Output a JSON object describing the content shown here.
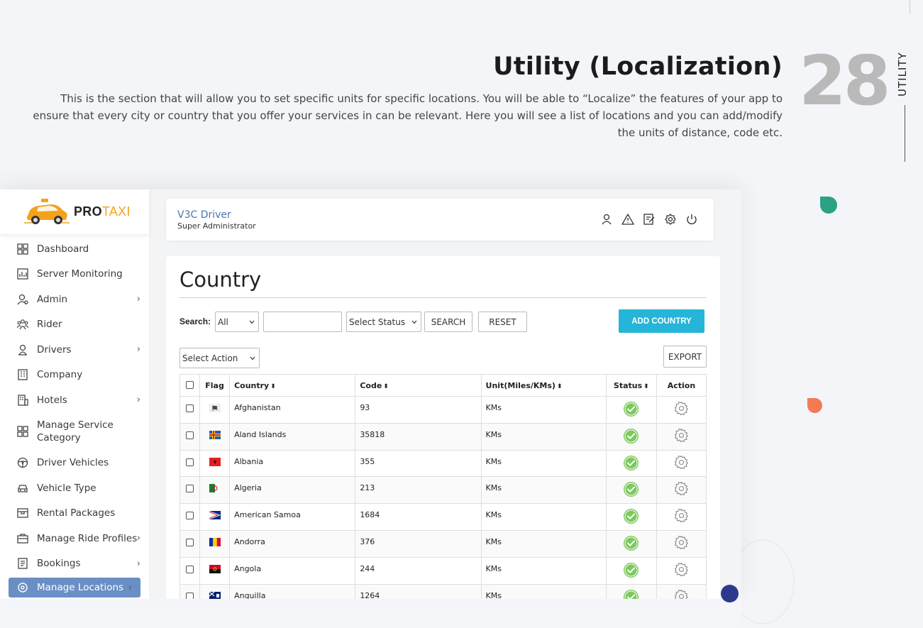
{
  "doc": {
    "title": "Utility (Localization)",
    "description": "This is the section that will allow you to set specific units for specific locations. You will be able to “Localize” the features of your app to ensure that every city or country that you offer your services in can be relevant. Here you will see a list of locations and you can add/modify the units of distance, code etc.",
    "page_number": "28",
    "section_label": "UTILITY"
  },
  "app": {
    "logo": {
      "part1": "PRO",
      "part2": "TAXI"
    },
    "user": {
      "name": "V3C Driver",
      "role": "Super Administrator"
    },
    "sidebar": {
      "items": [
        {
          "label": "Dashboard",
          "icon": "dashboard-icon"
        },
        {
          "label": "Server Monitoring",
          "icon": "chart-icon"
        },
        {
          "label": "Admin",
          "icon": "admin-icon",
          "has_children": true
        },
        {
          "label": "Rider",
          "icon": "rider-icon"
        },
        {
          "label": "Drivers",
          "icon": "driver-icon",
          "has_children": true
        },
        {
          "label": "Company",
          "icon": "company-icon"
        },
        {
          "label": "Hotels",
          "icon": "hotel-icon",
          "has_children": true
        },
        {
          "label": "Manage Service Category",
          "icon": "category-icon"
        },
        {
          "label": "Driver Vehicles",
          "icon": "steering-icon"
        },
        {
          "label": "Vehicle Type",
          "icon": "vehicle-icon"
        },
        {
          "label": "Rental Packages",
          "icon": "package-icon"
        },
        {
          "label": "Manage Ride Profiles",
          "icon": "briefcase-icon",
          "has_children": true
        },
        {
          "label": "Bookings",
          "icon": "booking-icon",
          "has_children": true
        },
        {
          "label": "Manage Locations",
          "icon": "location-icon",
          "has_children": true,
          "active": true
        }
      ],
      "chevron": "›"
    },
    "page": {
      "title": "Country",
      "search_label": "Search:",
      "search_field_select": "All",
      "search_input_value": "",
      "status_select": "Select Status",
      "search_button": "SEARCH",
      "reset_button": "RESET",
      "add_button": "ADD COUNTRY",
      "action_select": "Select Action",
      "export_button": "EXPORT"
    },
    "table": {
      "headers": {
        "flag": "Flag",
        "country": "Country",
        "code": "Code",
        "unit": "Unit(Miles/KMs)",
        "status": "Status",
        "action": "Action"
      },
      "sort_glyph": "⬍",
      "rows": [
        {
          "country": "Afghanistan",
          "code": "93",
          "unit": "KMs",
          "flag": "af"
        },
        {
          "country": "Aland Islands",
          "code": "35818",
          "unit": "KMs",
          "flag": "ax"
        },
        {
          "country": "Albania",
          "code": "355",
          "unit": "KMs",
          "flag": "al"
        },
        {
          "country": "Algeria",
          "code": "213",
          "unit": "KMs",
          "flag": "dz"
        },
        {
          "country": "American Samoa",
          "code": "1684",
          "unit": "KMs",
          "flag": "as"
        },
        {
          "country": "Andorra",
          "code": "376",
          "unit": "KMs",
          "flag": "ad"
        },
        {
          "country": "Angola",
          "code": "244",
          "unit": "KMs",
          "flag": "ao"
        },
        {
          "country": "Anguilla",
          "code": "1264",
          "unit": "KMs",
          "flag": "ai"
        }
      ]
    }
  },
  "colors": {
    "accent": "#24b5d8",
    "active_nav": "#6a8fc4",
    "status_ok": "#7cc95e",
    "user_name": "#4a76b3"
  }
}
